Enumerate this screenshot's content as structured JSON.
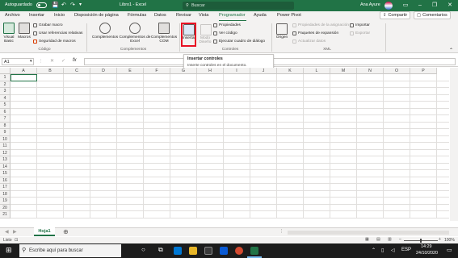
{
  "titlebar": {
    "autosave_label": "Autoguardado",
    "window_title": "Libro1 - Excel",
    "search_placeholder": "Buscar",
    "user_name": "Ana Ayure",
    "accent_color": "#217346"
  },
  "tabs": [
    "Archivo",
    "Insertar",
    "Inicio",
    "Disposición de página",
    "Fórmulas",
    "Datos",
    "Revisar",
    "Vista",
    "Programador",
    "Ayuda",
    "Power Pivot"
  ],
  "active_tab": "Programador",
  "share_label": "Compartir",
  "comments_label": "Comentarios",
  "ribbon": {
    "codigo": {
      "visual_basic": "Visual Basic",
      "macros": "Macros",
      "grabar_macro": "Grabar macro",
      "usar_referencias": "Usar referencias relativas",
      "seguridad_macros": "Seguridad de macros",
      "group_label": "Código"
    },
    "complementos": {
      "complementos": "Complementos",
      "complementos_excel": "Complementos de Excel",
      "complementos_com": "Complementos COM",
      "group_label": "Complementos"
    },
    "controles": {
      "insertar": "Insertar",
      "modo_diseno": "Modo Diseño",
      "propiedades": "Propiedades",
      "ver_codigo": "Ver código",
      "ejecutar_cuadro": "Ejecutar cuadro de diálogo",
      "group_label": "Controles"
    },
    "xml": {
      "origen": "Origen",
      "propiedades_asignacion": "Propiedades de la asignación",
      "paquetes_expansion": "Paquetes de expansión",
      "actualizar_datos": "Actualizar datos",
      "importar": "Importar",
      "exportar": "Exportar",
      "group_label": "XML"
    }
  },
  "tooltip": {
    "title": "Insertar controles",
    "description": "Inserte controles en el documento."
  },
  "formula_bar": {
    "name_box": "A1",
    "fx": "fx",
    "value": ""
  },
  "grid": {
    "columns": [
      "A",
      "B",
      "C",
      "D",
      "E",
      "F",
      "G",
      "H",
      "I",
      "J",
      "K",
      "L",
      "M",
      "N",
      "O",
      "P"
    ],
    "rows": [
      "1",
      "2",
      "3",
      "4",
      "5",
      "6",
      "7",
      "8",
      "9",
      "10",
      "11",
      "12",
      "13",
      "14",
      "15",
      "16",
      "17",
      "18",
      "19",
      "20",
      "21"
    ]
  },
  "sheet_tab": "Hoja1",
  "status": {
    "ready": "Listo",
    "zoom": "100%"
  },
  "taskbar": {
    "search_placeholder": "Escribe aquí para buscar",
    "language": "ESP",
    "time": "14:29",
    "date": "24/10/2020"
  }
}
